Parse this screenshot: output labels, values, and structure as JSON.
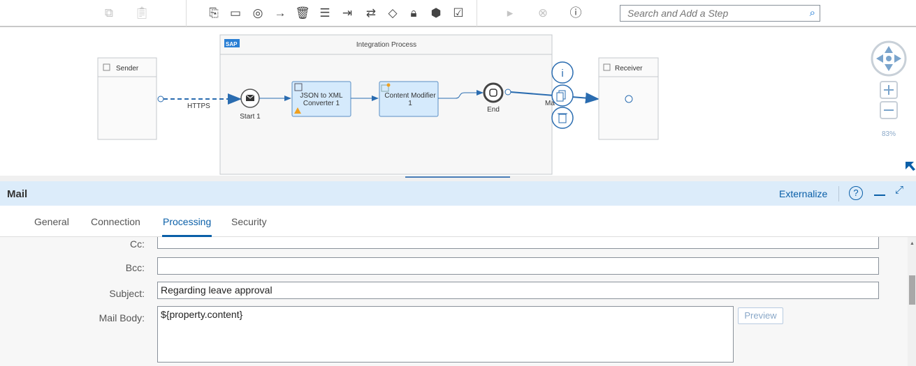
{
  "toolbar": {
    "icons": [
      "copy-icon",
      "paste-icon",
      "add-step-icon",
      "participant-icon",
      "target-icon",
      "connector-arrow-icon",
      "delete-icon",
      "menu-icon",
      "import-icon",
      "exchange-icon",
      "router-diamond-icon",
      "lock-icon",
      "hexagon-icon",
      "clipboard-check-icon",
      "simulate-play-icon",
      "cancel-simulation-icon",
      "help-icon"
    ],
    "search_placeholder": "Search and Add a Step"
  },
  "diagram": {
    "sender": "Sender",
    "receiver": "Receiver",
    "process_title": "Integration Process",
    "sap_logo": "SAP",
    "sender_adapter": "HTTPS",
    "start": "Start 1",
    "json_line1": "JSON to XML",
    "json_line2": "Converter 1",
    "cm_line1": "Content Modifier",
    "cm_line2": "1",
    "end": "End",
    "receiver_adapter": "Ma",
    "zoom": "83%"
  },
  "panel": {
    "title": "Mail",
    "externalize": "Externalize",
    "tabs": [
      {
        "label": "General"
      },
      {
        "label": "Connection"
      },
      {
        "label": "Processing",
        "active": true
      },
      {
        "label": "Security"
      }
    ],
    "fields": {
      "cc_label": "Cc:",
      "cc_value": "",
      "bcc_label": "Bcc:",
      "bcc_value": "",
      "subject_label": "Subject:",
      "subject_value": "Regarding leave approval",
      "body_label": "Mail Body:",
      "body_value": "${property.content}",
      "preview": "Preview"
    }
  },
  "colors": {
    "accent": "#0a5fa8",
    "panel_header": "#dcecfa",
    "step_fill": "#d5eafc"
  }
}
